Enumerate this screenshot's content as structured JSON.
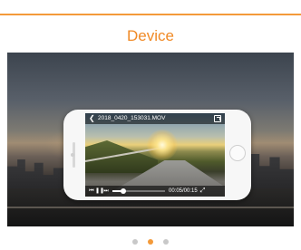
{
  "header": {
    "title": "Device"
  },
  "player": {
    "filename": "2018_0420_153031.MOV",
    "time": "00:05/00:15",
    "progress_fraction": 0.2,
    "icons": {
      "back": "chevron-left-icon",
      "share": "share-icon",
      "previous": "skip-previous-icon",
      "pause": "pause-icon",
      "next": "skip-next-icon",
      "fullscreen": "fullscreen-icon"
    }
  },
  "pager": {
    "count": 3,
    "active_index": 1
  },
  "colors": {
    "accent": "#f39a3a"
  }
}
